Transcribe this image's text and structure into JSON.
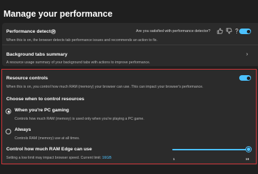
{
  "page": {
    "title": "Manage your performance"
  },
  "performance_detector": {
    "title": "Performance detector",
    "description": "When this is on, the browser detects tab performance issues and recommends an action to fix.",
    "feedback_question": "Are you satisfied with performance detector?",
    "toggle_on": true
  },
  "background_tabs": {
    "title": "Background tabs summary",
    "description": "A resource usage summary of your background tabs with actions to improve performance."
  },
  "resource_controls": {
    "title": "Resource controls",
    "description": "When this is on, you control how much RAM (memory) your browser can use. This can impact your browser's performance.",
    "toggle_on": true,
    "choose_heading": "Choose when to control resources",
    "options": [
      {
        "label": "When you're PC gaming",
        "description": "Controls how much RAM (memory) is used only when you're playing a PC game.",
        "selected": true
      },
      {
        "label": "Always",
        "description": "Controls RAM (memory) use at all times.",
        "selected": false
      }
    ],
    "ram_label": "Control how much RAM Edge can use",
    "ram_note_prefix": "Setting a low limit may impact browser speed. Current limit: ",
    "ram_current_limit": "16GB",
    "slider_min": "1",
    "slider_max": "16",
    "slider_value": 16
  },
  "colors": {
    "accent": "#4cc2ff",
    "highlight_border": "#d13438"
  },
  "icons": [
    "info-icon",
    "thumbs-up-icon",
    "thumbs-down-icon",
    "help-icon",
    "chevron-right-icon"
  ]
}
